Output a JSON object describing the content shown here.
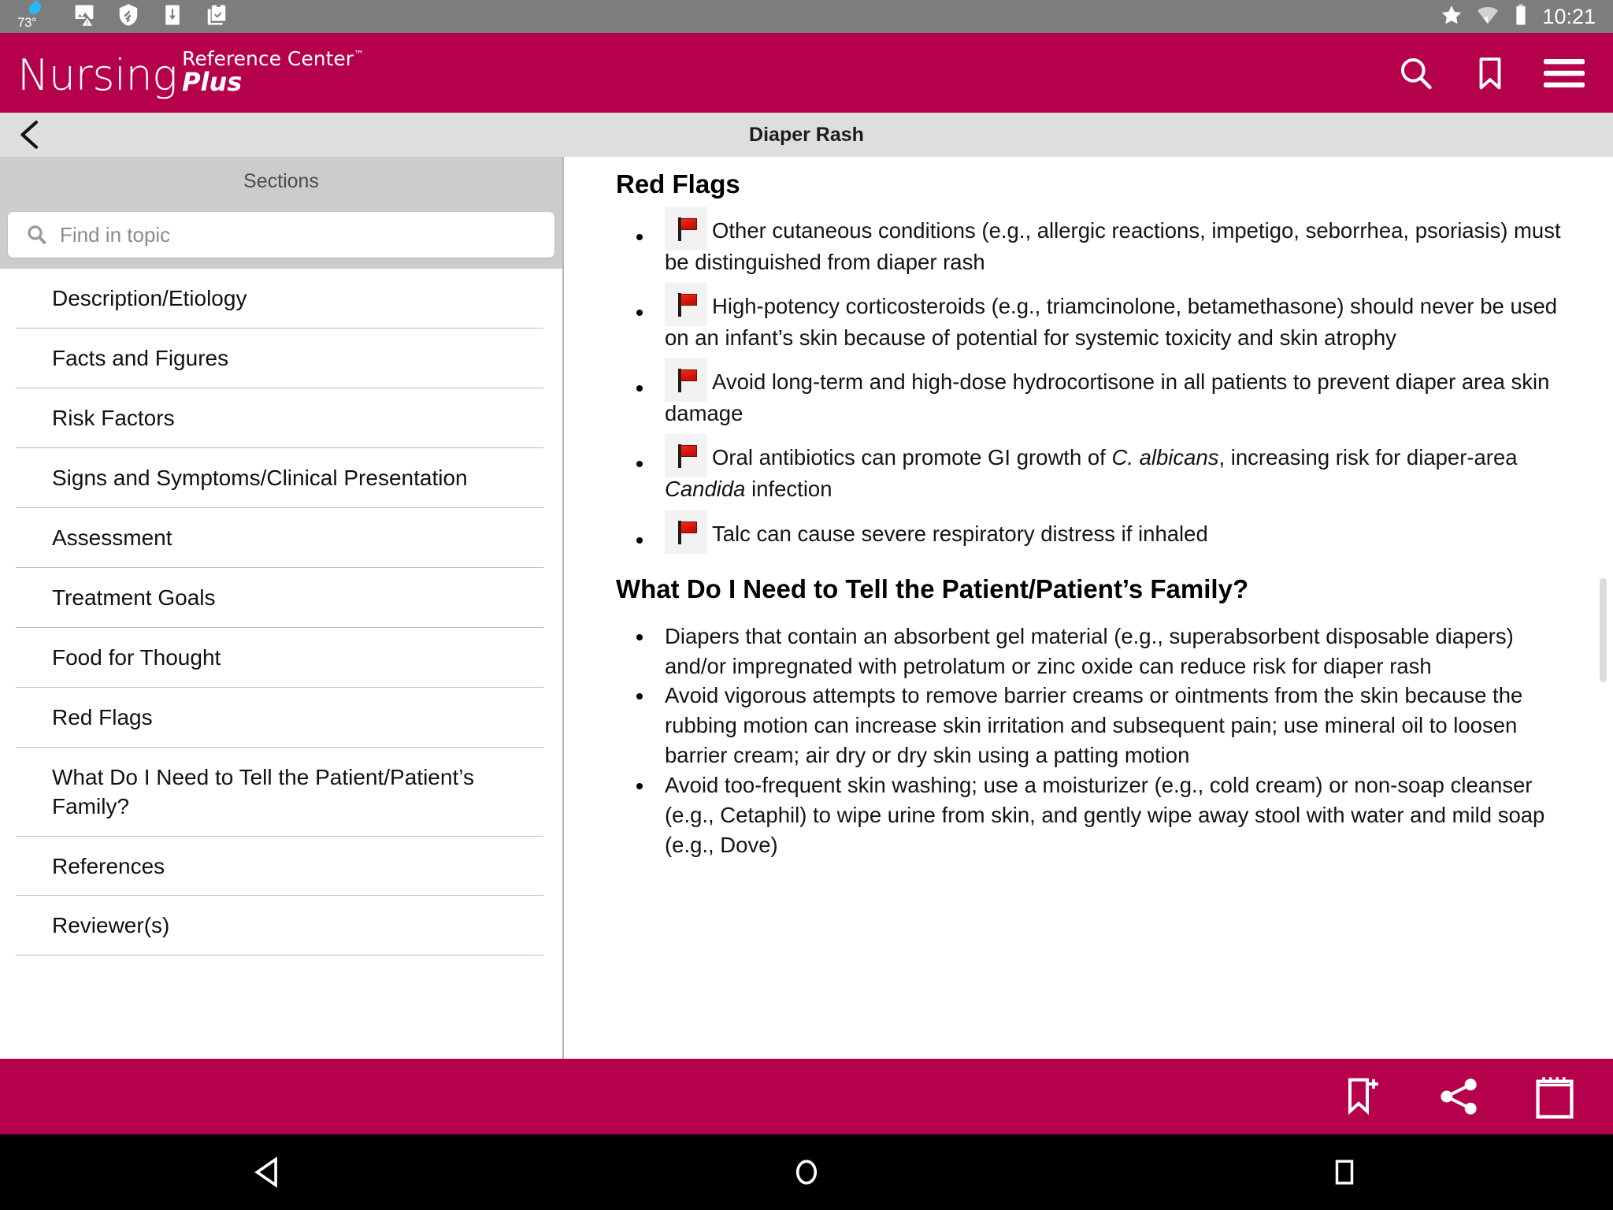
{
  "statusbar": {
    "temperature": "73°",
    "icons": [
      "water-drop-icon",
      "image-warning-icon",
      "security-shield-icon",
      "download-icon",
      "clipboard-check-icon"
    ],
    "right_icons": [
      "star-icon",
      "wifi-icon",
      "battery-icon"
    ],
    "clock": "10:21"
  },
  "header": {
    "brand_primary": "Nursing",
    "brand_secondary": "Reference Center",
    "brand_trademark": "™",
    "brand_tertiary": "Plus",
    "accent_color": "#b5004b",
    "actions": [
      {
        "name": "search-icon",
        "label": "Search"
      },
      {
        "name": "bookmark-icon",
        "label": "Bookmarks"
      },
      {
        "name": "hamburger-menu-icon",
        "label": "Menu"
      }
    ]
  },
  "titlebar": {
    "back_label": "Back",
    "title": "Diaper Rash"
  },
  "sidebar": {
    "panel_title": "Sections",
    "search": {
      "placeholder": "Find in topic",
      "value": "",
      "icon": "search-icon"
    },
    "items": [
      {
        "label": "Description/Etiology"
      },
      {
        "label": "Facts and Figures"
      },
      {
        "label": "Risk Factors"
      },
      {
        "label": "Signs and Symptoms/Clinical Presentation"
      },
      {
        "label": "Assessment"
      },
      {
        "label": "Treatment Goals"
      },
      {
        "label": "Food for Thought"
      },
      {
        "label": "Red Flags"
      },
      {
        "label": "What Do I Need to Tell the Patient/Patient’s Family?"
      },
      {
        "label": "References"
      },
      {
        "label": "Reviewer(s)"
      }
    ]
  },
  "content": {
    "section1": {
      "heading": "Red Flags",
      "bullets": [
        {
          "text": "Other cutaneous conditions (e.g., allergic reactions, impetigo, seborrhea, psoriasis) must be distinguished from diaper rash"
        },
        {
          "text": "High-potency corticosteroids (e.g., triamcinolone, betamethasone) should never be used on an infant’s skin because of potential for systemic toxicity and skin atrophy"
        },
        {
          "text": "Avoid long-term and high-dose hydrocortisone in all patients to prevent diaper area skin damage"
        },
        {
          "html": "Oral antibiotics can promote GI growth of <em>C. albicans</em>, increasing risk for diaper-area <em>Candida</em> infection"
        },
        {
          "text": "Talc can cause severe respiratory distress if inhaled"
        }
      ]
    },
    "section2": {
      "heading": "What Do I Need to Tell the Patient/Patient’s Family?",
      "bullets": [
        {
          "text": "Diapers that contain an absorbent gel material (e.g., superabsorbent disposable diapers) and/or impregnated with petrolatum or zinc oxide can reduce risk for diaper rash"
        },
        {
          "text": "Avoid vigorous attempts to remove barrier creams or ointments from the skin because the rubbing motion can increase skin irritation and subsequent pain; use mineral oil to loosen barrier cream; air dry or dry skin using a patting motion"
        },
        {
          "text": "Avoid too-frequent skin washing; use a moisturizer (e.g., cold cream) or non-soap cleanser (e.g., Cetaphil) to wipe urine from skin, and gently wipe away stool with water and mild soap (e.g., Dove)"
        }
      ]
    }
  },
  "bottombar": {
    "actions": [
      {
        "name": "add-bookmark-icon",
        "label": "Add bookmark"
      },
      {
        "name": "share-icon",
        "label": "Share"
      },
      {
        "name": "notepad-icon",
        "label": "Notes"
      }
    ]
  },
  "navbar": {
    "buttons": [
      {
        "name": "android-back-icon",
        "label": "Back"
      },
      {
        "name": "android-home-icon",
        "label": "Home"
      },
      {
        "name": "android-recents-icon",
        "label": "Recent apps"
      }
    ]
  }
}
